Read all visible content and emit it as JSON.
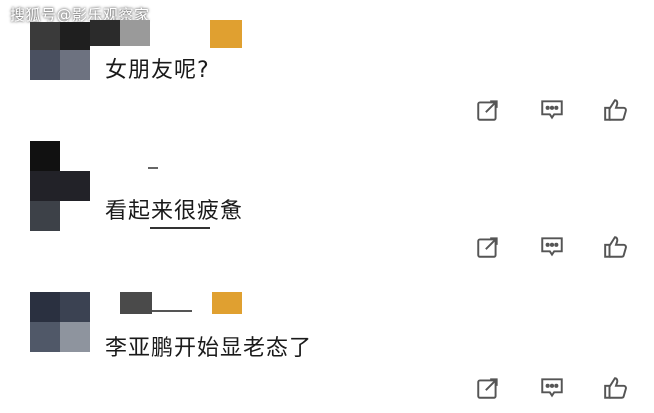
{
  "watermark": "搜狐号@影乐观察家",
  "comments": [
    {
      "text": "女朋友呢?"
    },
    {
      "text": "看起来很疲惫"
    },
    {
      "text": "李亚鹏开始显老态了"
    }
  ],
  "icons": {
    "share": "share-icon",
    "reply": "comment-icon",
    "like": "thumbs-up-icon"
  },
  "colors": {
    "text": "#1a1a1a",
    "icon": "#555555",
    "badge": "#e0a030"
  }
}
